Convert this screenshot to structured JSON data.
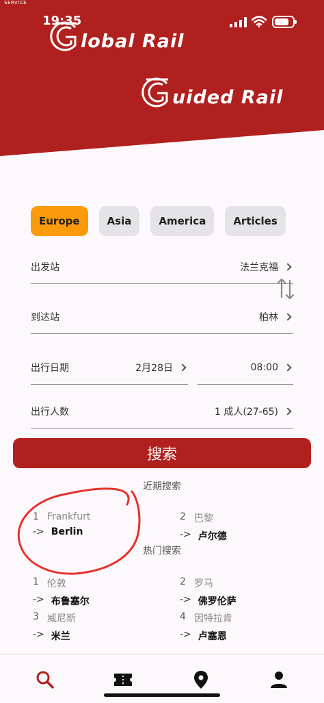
{
  "status_bar": {
    "carrier": "SERVICE",
    "time": "19:35"
  },
  "brand": {
    "global_letter": "G",
    "global_text": "lobal Rail",
    "guided_letter": "G",
    "guided_text": "uided Rail",
    "color": "#b0201e"
  },
  "region_tabs": [
    {
      "label": "Europe",
      "active": true
    },
    {
      "label": "Asia",
      "active": false
    },
    {
      "label": "America",
      "active": false
    },
    {
      "label": "Articles",
      "active": false
    }
  ],
  "form": {
    "departure_label": "出发站",
    "departure_value": "法兰克福",
    "arrival_label": "到达站",
    "arrival_value": "柏林",
    "date_label": "出行日期",
    "date_value": "2月28日",
    "time_value": "08:00",
    "passengers_label": "出行人数",
    "passengers_value": "1 成人(27-65)"
  },
  "search_button": "搜索",
  "recent": {
    "title": "近期搜索",
    "items": [
      {
        "n": "1",
        "from": "Frankfurt",
        "to": "Berlin"
      },
      {
        "n": "2",
        "from": "巴黎",
        "to": "卢尔德"
      }
    ]
  },
  "popular": {
    "title": "热门搜索",
    "items": [
      {
        "n": "1",
        "from": "伦敦",
        "to": "布鲁塞尔"
      },
      {
        "n": "2",
        "from": "罗马",
        "to": "佛罗伦萨"
      },
      {
        "n": "3",
        "from": "威尼斯",
        "to": "米兰"
      },
      {
        "n": "4",
        "from": "因特拉肯",
        "to": "卢塞恩"
      }
    ]
  },
  "arrow_text": "->",
  "accent_orange": "#fb9a0a",
  "bottom_nav": [
    {
      "icon": "search-icon",
      "active": true
    },
    {
      "icon": "ticket-icon",
      "active": false
    },
    {
      "icon": "location-pin-icon",
      "active": false
    },
    {
      "icon": "person-icon",
      "active": false
    }
  ]
}
